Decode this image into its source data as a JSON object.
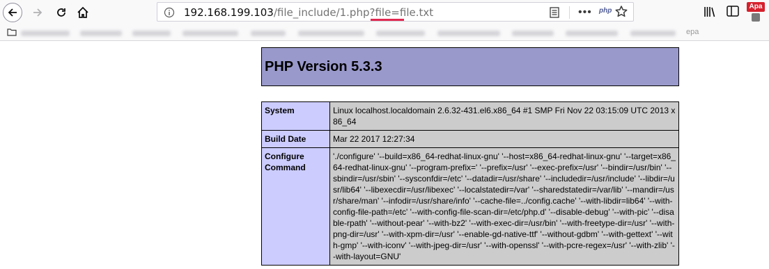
{
  "browser": {
    "url_host": "192.168.199.103",
    "url_path": "/file_include/1.php?file=",
    "url_param_value": "file.txt",
    "php_extension_label": "php",
    "extension_badge": "Apa",
    "bookmarks_tail_text": "ера"
  },
  "page": {
    "title": "PHP Version 5.3.3",
    "rows": [
      {
        "key": "System",
        "value": "Linux localhost.localdomain 2.6.32-431.el6.x86_64 #1 SMP Fri Nov 22 03:15:09 UTC 2013 x86_64"
      },
      {
        "key": "Build Date",
        "value": "Mar 22 2017 12:27:34"
      },
      {
        "key": "Configure Command",
        "value": "'./configure' '--build=x86_64-redhat-linux-gnu' '--host=x86_64-redhat-linux-gnu' '--target=x86_64-redhat-linux-gnu' '--program-prefix=' '--prefix=/usr' '--exec-prefix=/usr' '--bindir=/usr/bin' '--sbindir=/usr/sbin' '--sysconfdir=/etc' '--datadir=/usr/share' '--includedir=/usr/include' '--libdir=/usr/lib64' '--libexecdir=/usr/libexec' '--localstatedir=/var' '--sharedstatedir=/var/lib' '--mandir=/usr/share/man' '--infodir=/usr/share/info' '--cache-file=../config.cache' '--with-libdir=lib64' '--with-config-file-path=/etc' '--with-config-file-scan-dir=/etc/php.d' '--disable-debug' '--with-pic' '--disable-rpath' '--without-pear' '--with-bz2' '--with-exec-dir=/usr/bin' '--with-freetype-dir=/usr' '--with-png-dir=/usr' '--with-xpm-dir=/usr' '--enable-gd-native-ttf' '--without-gdbm' '--with-gettext' '--with-gmp' '--with-iconv' '--with-jpeg-dir=/usr' '--with-openssl' '--with-pcre-regex=/usr' '--with-zlib' '--with-layout=GNU'"
      }
    ]
  },
  "colors": {
    "header_bg": "#9999cc",
    "key_bg": "#ccccff",
    "value_bg": "#cccccc",
    "url_highlight": "#e22850"
  }
}
